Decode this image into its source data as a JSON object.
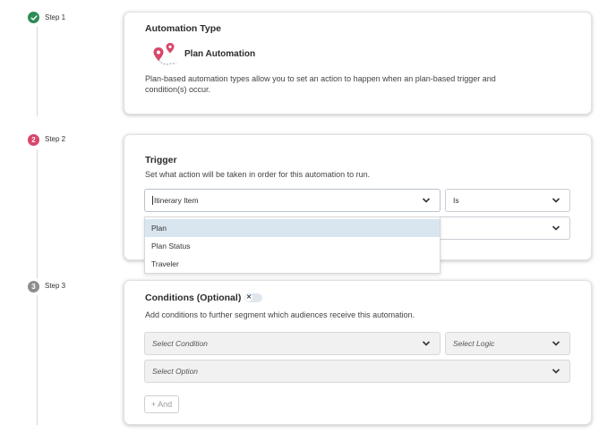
{
  "steps": [
    {
      "label": "Step 1",
      "marker": "",
      "status": "complete",
      "color": "#2e8b57"
    },
    {
      "label": "Step 2",
      "marker": "2",
      "status": "current",
      "color": "#d9466b"
    },
    {
      "label": "Step 3",
      "marker": "3",
      "status": "upcoming",
      "color": "#8e8e8e"
    }
  ],
  "automation_type": {
    "title": "Automation Type",
    "option_label": "Plan Automation",
    "option_icon": "map-pins-icon",
    "description": "Plan-based automation types allow you to set an action to happen when an plan-based trigger and condition(s) occur."
  },
  "trigger": {
    "title": "Trigger",
    "subtitle": "Set what action will be taken in order for this automation to run.",
    "field_value": "Itinerary Item",
    "operator_value": "Is",
    "value_select": "",
    "dropdown_options": [
      "Plan",
      "Plan Status",
      "Traveler"
    ],
    "highlighted_option": "Plan"
  },
  "conditions": {
    "title": "Conditions (Optional)",
    "toggle_symbol": "✕",
    "subtitle": "Add conditions to further segment which audiences receive this automation.",
    "condition_placeholder": "Select Condition",
    "logic_placeholder": "Select Logic",
    "option_placeholder": "Select Option",
    "add_button": "+ And"
  },
  "colors": {
    "accent_pink": "#d9466b",
    "success_green": "#2e8b57",
    "highlight": "#d9e6ef"
  }
}
